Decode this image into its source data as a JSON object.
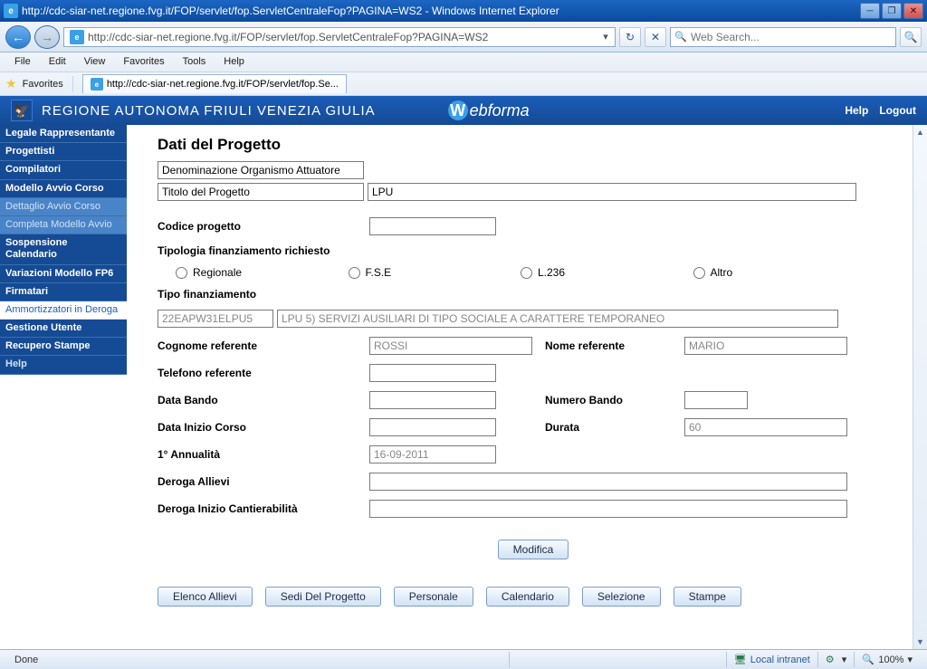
{
  "window": {
    "title": "http://cdc-siar-net.regione.fvg.it/FOP/servlet/fop.ServletCentraleFop?PAGINA=WS2 - Windows Internet Explorer",
    "url": "http://cdc-siar-net.regione.fvg.it/FOP/servlet/fop.ServletCentraleFop?PAGINA=WS2",
    "search_placeholder": "Web Search..."
  },
  "menu": {
    "file": "File",
    "edit": "Edit",
    "view": "View",
    "favorites": "Favorites",
    "tools": "Tools",
    "help": "Help"
  },
  "favbar": {
    "favorites": "Favorites",
    "tab": "http://cdc-siar-net.regione.fvg.it/FOP/servlet/fop.Se..."
  },
  "brand": {
    "region": "REGIONE AUTONOMA FRIULI VENEZIA GIULIA",
    "app_w": "W",
    "app_name": "ebforma",
    "help": "Help",
    "logout": "Logout"
  },
  "sidebar": {
    "items": [
      "Legale Rappresentante",
      "Progettisti",
      "Compilatori",
      "Modello Avvio Corso",
      "Dettaglio Avvio Corso",
      "Completa Modello Avvio",
      "Sospensione Calendario",
      "Variazioni Modello FP6",
      "Firmatari",
      "Ammortizzatori in Deroga",
      "Gestione Utente",
      "Recupero Stampe",
      "Help"
    ]
  },
  "page": {
    "title": "Dati del Progetto",
    "denominazione": "Denominazione Organismo Attuatore",
    "titolo_label": "Titolo del Progetto",
    "titolo_value": "LPU",
    "codice_label": "Codice progetto",
    "codice_value": "",
    "tipologia_label": "Tipologia finanziamento richiesto",
    "radio": {
      "regionale": "Regionale",
      "fse": "F.S.E",
      "l236": "L.236",
      "altro": "Altro"
    },
    "tipo_fin_label": "Tipo finanziamento",
    "tipo_code": "22EAPW31ELPU5",
    "tipo_desc": "LPU 5) SERVIZI AUSILIARI DI TIPO SOCIALE A CARATTERE TEMPORANEO",
    "cognome_label": "Cognome referente",
    "cognome_value": "ROSSI",
    "nome_label": "Nome referente",
    "nome_value": "MARIO",
    "telefono_label": "Telefono referente",
    "telefono_value": "",
    "databando_label": "Data Bando",
    "databando_value": "",
    "numbando_label": "Numero Bando",
    "numbando_value": "",
    "datainizio_label": "Data Inizio Corso",
    "datainizio_value": "",
    "durata_label": "Durata",
    "durata_value": "60",
    "annualita_label": "1° Annualità",
    "annualita_value": "16-09-2011",
    "deroga_allievi_label": "Deroga Allievi",
    "deroga_allievi_value": "",
    "deroga_cant_label": "Deroga Inizio Cantierabilità",
    "deroga_cant_value": "",
    "modifica": "Modifica",
    "buttons": [
      "Elenco Allievi",
      "Sedi Del Progetto",
      "Personale",
      "Calendario",
      "Selezione",
      "Stampe"
    ]
  },
  "status": {
    "done": "Done",
    "zone": "Local intranet",
    "zoom": "100%"
  }
}
